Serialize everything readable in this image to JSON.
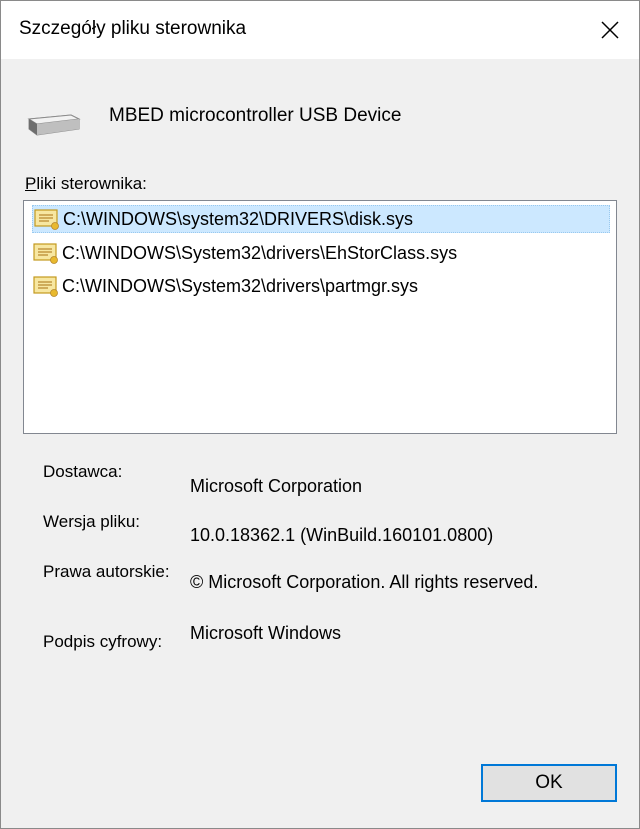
{
  "window": {
    "title": "Szczegóły pliku sterownika"
  },
  "device": {
    "name": "MBED microcontroller USB Device",
    "icon": "drive-icon"
  },
  "files": {
    "label_accel": "P",
    "label_rest": "liki sterownika:",
    "items": [
      {
        "path": "C:\\WINDOWS\\system32\\DRIVERS\\disk.sys",
        "selected": true
      },
      {
        "path": "C:\\WINDOWS\\System32\\drivers\\EhStorClass.sys",
        "selected": false
      },
      {
        "path": "C:\\WINDOWS\\System32\\drivers\\partmgr.sys",
        "selected": false
      }
    ]
  },
  "details": {
    "provider_label": "Dostawca:",
    "provider_value": "Microsoft Corporation",
    "version_label": "Wersja pliku:",
    "version_value": "10.0.18362.1 (WinBuild.160101.0800)",
    "copyright_label": "Prawa autorskie:",
    "copyright_value": "© Microsoft Corporation. All rights reserved.",
    "signature_label": "Podpis cyfrowy:",
    "signature_value": "Microsoft Windows"
  },
  "buttons": {
    "ok_label": "OK"
  },
  "colors": {
    "selection": "#cce8ff",
    "accent": "#0078d7"
  }
}
